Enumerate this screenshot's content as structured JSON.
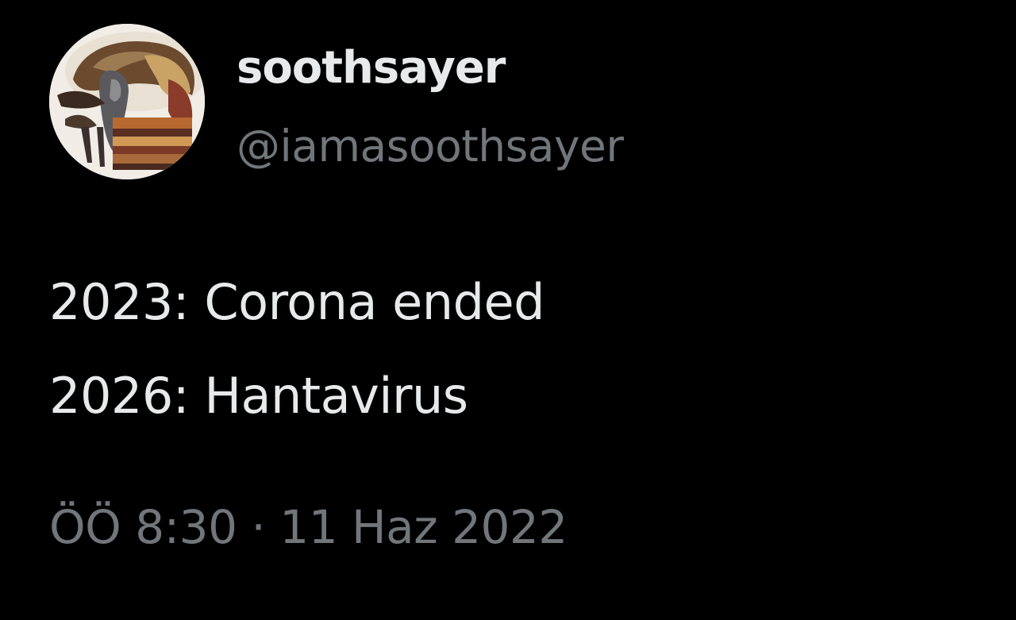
{
  "tweet": {
    "author": {
      "display_name": "soothsayer",
      "handle": "@iamasoothsayer",
      "avatar_icon": "painted-figure-avatar"
    },
    "text_lines": [
      "2023: Corona ended",
      "2026: Hantavirus"
    ],
    "timestamp": "ÖÖ 8:30 · 11 Haz 2022"
  },
  "colors": {
    "background": "#000000",
    "primary_text": "#e7e9ea",
    "secondary_text": "#71767b"
  }
}
